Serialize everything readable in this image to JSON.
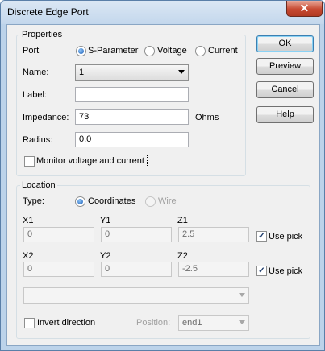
{
  "window": {
    "title": "Discrete Edge Port",
    "close_glyph": "✕"
  },
  "buttons": {
    "ok": "OK",
    "preview": "Preview",
    "cancel": "Cancel",
    "help": "Help"
  },
  "properties": {
    "group_label": "Properties",
    "port_label": "Port",
    "port_options": [
      "S-Parameter",
      "Voltage",
      "Current"
    ],
    "port_selected": "S-Parameter",
    "name_label": "Name:",
    "name_value": "1",
    "label_label": "Label:",
    "label_value": "",
    "impedance_label": "Impedance:",
    "impedance_value": "73",
    "impedance_unit": "Ohms",
    "radius_label": "Radius:",
    "radius_value": "0.0",
    "monitor_label": "Monitor voltage and current",
    "monitor_checked": false
  },
  "location": {
    "group_label": "Location",
    "type_label": "Type:",
    "type_options": [
      "Coordinates",
      "Wire"
    ],
    "type_selected": "Coordinates",
    "x1_label": "X1",
    "x1_value": "0",
    "y1_label": "Y1",
    "y1_value": "0",
    "z1_label": "Z1",
    "z1_value": "2.5",
    "x2_label": "X2",
    "x2_value": "0",
    "y2_label": "Y2",
    "y2_value": "0",
    "z2_label": "Z2",
    "z2_value": "-2.5",
    "use_pick_label": "Use pick",
    "use_pick_1_checked": true,
    "use_pick_2_checked": true,
    "wire_select_value": "",
    "invert_label": "Invert direction",
    "invert_checked": false,
    "position_label": "Position:",
    "position_value": "end1"
  },
  "icons": {
    "check_glyph": "✓"
  },
  "colors": {
    "title_bar": "#c3d7ec",
    "close_button": "#c74a32",
    "dialog_bg": "#f0f0f0",
    "radio_dot": "#1c5fb8"
  }
}
